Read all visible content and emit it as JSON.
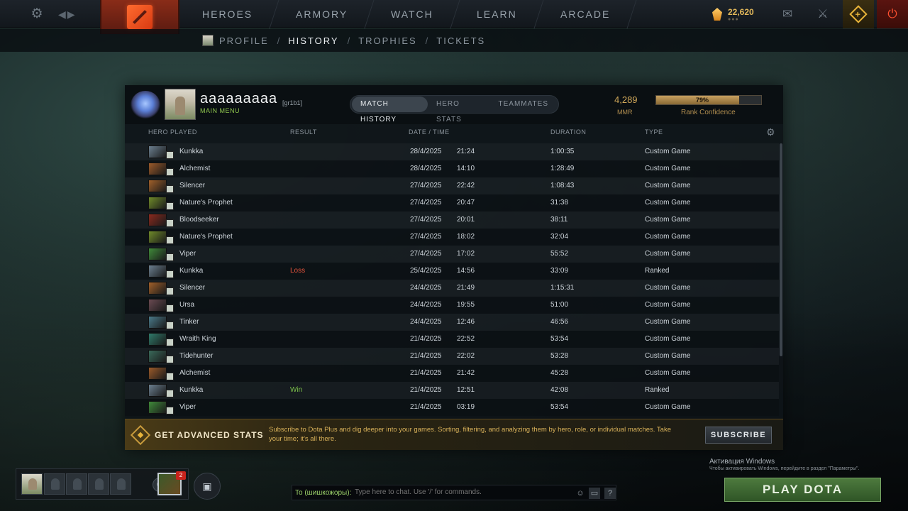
{
  "topnav": {
    "items": [
      "HEROES",
      "ARMORY",
      "WATCH",
      "LEARN",
      "ARCADE"
    ],
    "gold_amount": "22,620"
  },
  "subnav": {
    "items": [
      "PROFILE",
      "HISTORY",
      "TROPHIES",
      "TICKETS"
    ],
    "active": "HISTORY",
    "separator": "/"
  },
  "player": {
    "name": "aaaaaaaaa",
    "tag": "[gr1b1]",
    "status": "MAIN MENU"
  },
  "tabs": [
    {
      "label": "MATCH HISTORY",
      "active": true
    },
    {
      "label": "HERO STATS",
      "active": false
    },
    {
      "label": "TEAMMATES",
      "active": false
    }
  ],
  "mmr": {
    "value": "4,289",
    "label": "MMR",
    "confidence_text": "79%",
    "confidence": 0.79,
    "confidence_label": "Rank Confidence"
  },
  "table": {
    "columns": [
      "HERO PLAYED",
      "RESULT",
      "DATE / TIME",
      "DURATION",
      "TYPE"
    ],
    "rows": [
      {
        "hero": "Kunkka",
        "result": "",
        "date": "28/4/2025",
        "time": "21:24",
        "duration": "1:00:35",
        "type": "Custom Game"
      },
      {
        "hero": "Alchemist",
        "result": "",
        "date": "28/4/2025",
        "time": "14:10",
        "duration": "1:28:49",
        "type": "Custom Game"
      },
      {
        "hero": "Silencer",
        "result": "",
        "date": "27/4/2025",
        "time": "22:42",
        "duration": "1:08:43",
        "type": "Custom Game"
      },
      {
        "hero": "Nature's Prophet",
        "result": "",
        "date": "27/4/2025",
        "time": "20:47",
        "duration": "31:38",
        "type": "Custom Game"
      },
      {
        "hero": "Bloodseeker",
        "result": "",
        "date": "27/4/2025",
        "time": "20:01",
        "duration": "38:11",
        "type": "Custom Game"
      },
      {
        "hero": "Nature's Prophet",
        "result": "",
        "date": "27/4/2025",
        "time": "18:02",
        "duration": "32:04",
        "type": "Custom Game"
      },
      {
        "hero": "Viper",
        "result": "",
        "date": "27/4/2025",
        "time": "17:02",
        "duration": "55:52",
        "type": "Custom Game"
      },
      {
        "hero": "Kunkka",
        "result": "Loss",
        "date": "25/4/2025",
        "time": "14:56",
        "duration": "33:09",
        "type": "Ranked"
      },
      {
        "hero": "Silencer",
        "result": "",
        "date": "24/4/2025",
        "time": "21:49",
        "duration": "1:15:31",
        "type": "Custom Game"
      },
      {
        "hero": "Ursa",
        "result": "",
        "date": "24/4/2025",
        "time": "19:55",
        "duration": "51:00",
        "type": "Custom Game"
      },
      {
        "hero": "Tinker",
        "result": "",
        "date": "24/4/2025",
        "time": "12:46",
        "duration": "46:56",
        "type": "Custom Game"
      },
      {
        "hero": "Wraith King",
        "result": "",
        "date": "21/4/2025",
        "time": "22:52",
        "duration": "53:54",
        "type": "Custom Game"
      },
      {
        "hero": "Tidehunter",
        "result": "",
        "date": "21/4/2025",
        "time": "22:02",
        "duration": "53:28",
        "type": "Custom Game"
      },
      {
        "hero": "Alchemist",
        "result": "",
        "date": "21/4/2025",
        "time": "21:42",
        "duration": "45:28",
        "type": "Custom Game"
      },
      {
        "hero": "Kunkka",
        "result": "Win",
        "date": "21/4/2025",
        "time": "12:51",
        "duration": "42:08",
        "type": "Ranked"
      },
      {
        "hero": "Viper",
        "result": "",
        "date": "21/4/2025",
        "time": "03:19",
        "duration": "53:54",
        "type": "Custom Game"
      }
    ]
  },
  "hero_colors": {
    "Kunkka": "#6b7f8f",
    "Alchemist": "#9a5a2a",
    "Silencer": "#a0602a",
    "Nature's Prophet": "#6f8a2a",
    "Bloodseeker": "#8a2a1e",
    "Viper": "#3f8a3a",
    "Ursa": "#6a4a52",
    "Tinker": "#4a7a8a",
    "Wraith King": "#2f7a6a",
    "Tidehunter": "#3a6a5a"
  },
  "advert": {
    "title": "GET ADVANCED STATS",
    "text": "Subscribe to Dota Plus and dig deeper into your games. Sorting, filtering, and analyzing them by hero, role, or individual matches. Take your time; it's all there.",
    "button": "SUBSCRIBE"
  },
  "party": {
    "notification_count": "2"
  },
  "chat": {
    "target": "To (шишкожоры):",
    "placeholder": "Type here to chat. Use '/' for commands."
  },
  "windows": {
    "title": "Активация Windows",
    "subtitle": "Чтобы активировать Windows, перейдите в раздел \"Параметры\"."
  },
  "play_button": "PLAY DOTA",
  "icons": {
    "settings": "gear-icon",
    "back_forward": "chevron-icon",
    "logo": "dota-logo-icon",
    "mail": "mail-icon",
    "armory": "armory-icon",
    "dota_plus": "dota-plus-icon",
    "power": "power-icon",
    "table_settings": "gear-icon",
    "voice": "headset-icon",
    "friends": "friends-icon",
    "emoji": "emoji-icon",
    "broadcast": "tv-icon",
    "help": "help-icon"
  }
}
